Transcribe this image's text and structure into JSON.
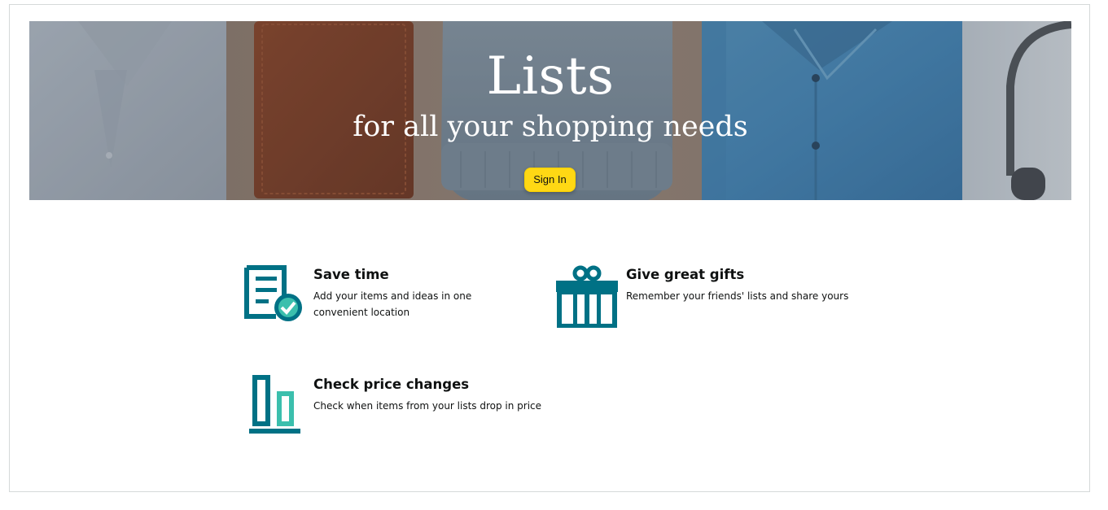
{
  "hero": {
    "title": "Lists",
    "subtitle": "for all your shopping needs",
    "signin_label": "Sign In"
  },
  "features": [
    {
      "title": "Save time",
      "description": "Add your items and ideas in one convenient location",
      "icon": "list-check-icon"
    },
    {
      "title": "Give great gifts",
      "description": "Remember your friends' lists and share yours",
      "icon": "gift-icon"
    },
    {
      "title": "Check price changes",
      "description": "Check when items from your lists drop in price",
      "icon": "price-bars-icon"
    }
  ],
  "colors": {
    "accent_teal": "#007185",
    "accent_light_teal": "#3bbfad",
    "button_yellow": "#ffd814"
  }
}
